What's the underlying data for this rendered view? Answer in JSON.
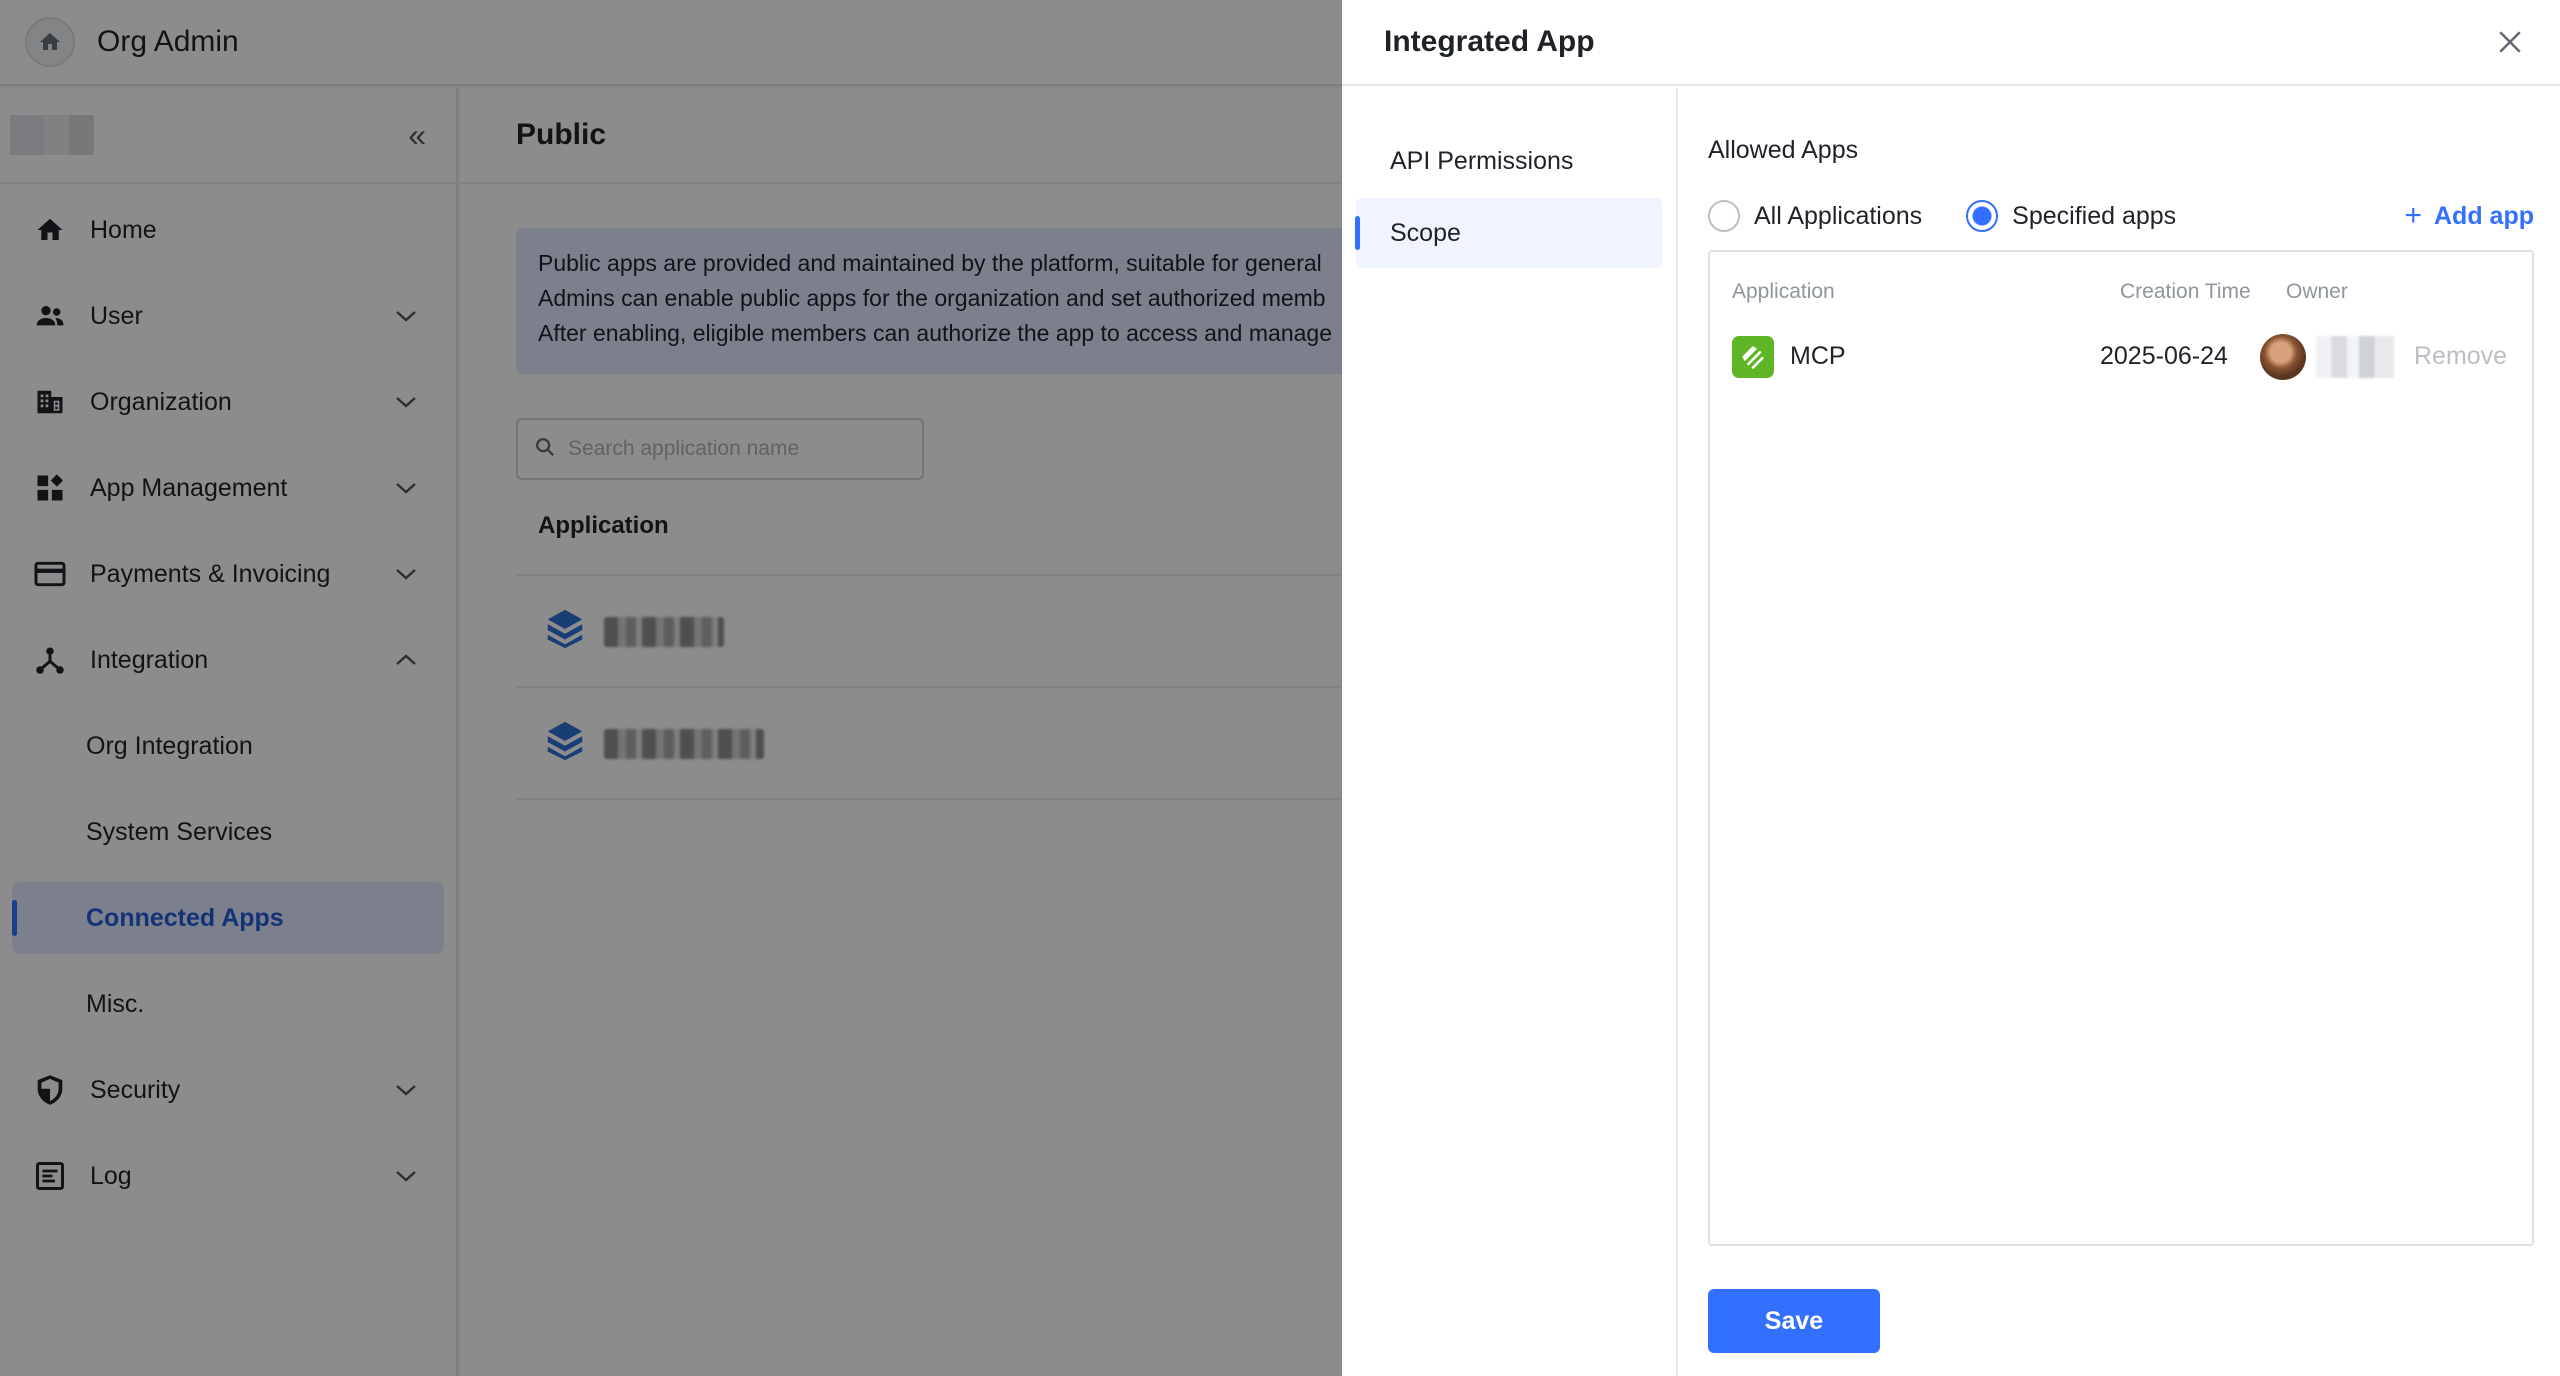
{
  "app": {
    "title": "Org Admin"
  },
  "sidebar": {
    "collapse_icon": "double-chevron-left-icon",
    "items": [
      {
        "label": "Home",
        "icon": "home-icon"
      },
      {
        "label": "User",
        "icon": "user-group-icon"
      },
      {
        "label": "Organization",
        "icon": "building-icon"
      },
      {
        "label": "App Management",
        "icon": "apps-icon"
      },
      {
        "label": "Payments & Invoicing",
        "icon": "credit-card-icon"
      },
      {
        "label": "Integration",
        "icon": "integration-icon"
      },
      {
        "label": "Org Integration"
      },
      {
        "label": "System Services"
      },
      {
        "label": "Connected Apps"
      },
      {
        "label": "Misc."
      },
      {
        "label": "Security",
        "icon": "shield-icon"
      },
      {
        "label": "Log",
        "icon": "log-icon"
      }
    ]
  },
  "main": {
    "title": "Public",
    "notice": [
      "Public apps are provided and maintained by the platform, suitable for general",
      "Admins can enable public apps for the organization and set authorized memb",
      "After enabling, eligible members can authorize the app to access and manage"
    ],
    "search_placeholder": "Search application name",
    "column_application": "Application"
  },
  "drawer": {
    "title": "Integrated App",
    "tabs": [
      "API Permissions",
      "Scope"
    ],
    "allowed_apps_label": "Allowed Apps",
    "radio_all": "All Applications",
    "radio_specified": "Specified apps",
    "selected_radio": "Specified apps",
    "add_app": "Add app",
    "table": {
      "headers": [
        "Application",
        "Creation Time",
        "Owner"
      ],
      "rows": [
        {
          "application": "MCP",
          "creation_time": "2025-06-24",
          "action": "Remove"
        }
      ]
    },
    "save": "Save"
  },
  "colors": {
    "accent": "#3370ff",
    "app_icon": "#5eb526",
    "overlay": "rgba(0,0,0,0.45)"
  }
}
